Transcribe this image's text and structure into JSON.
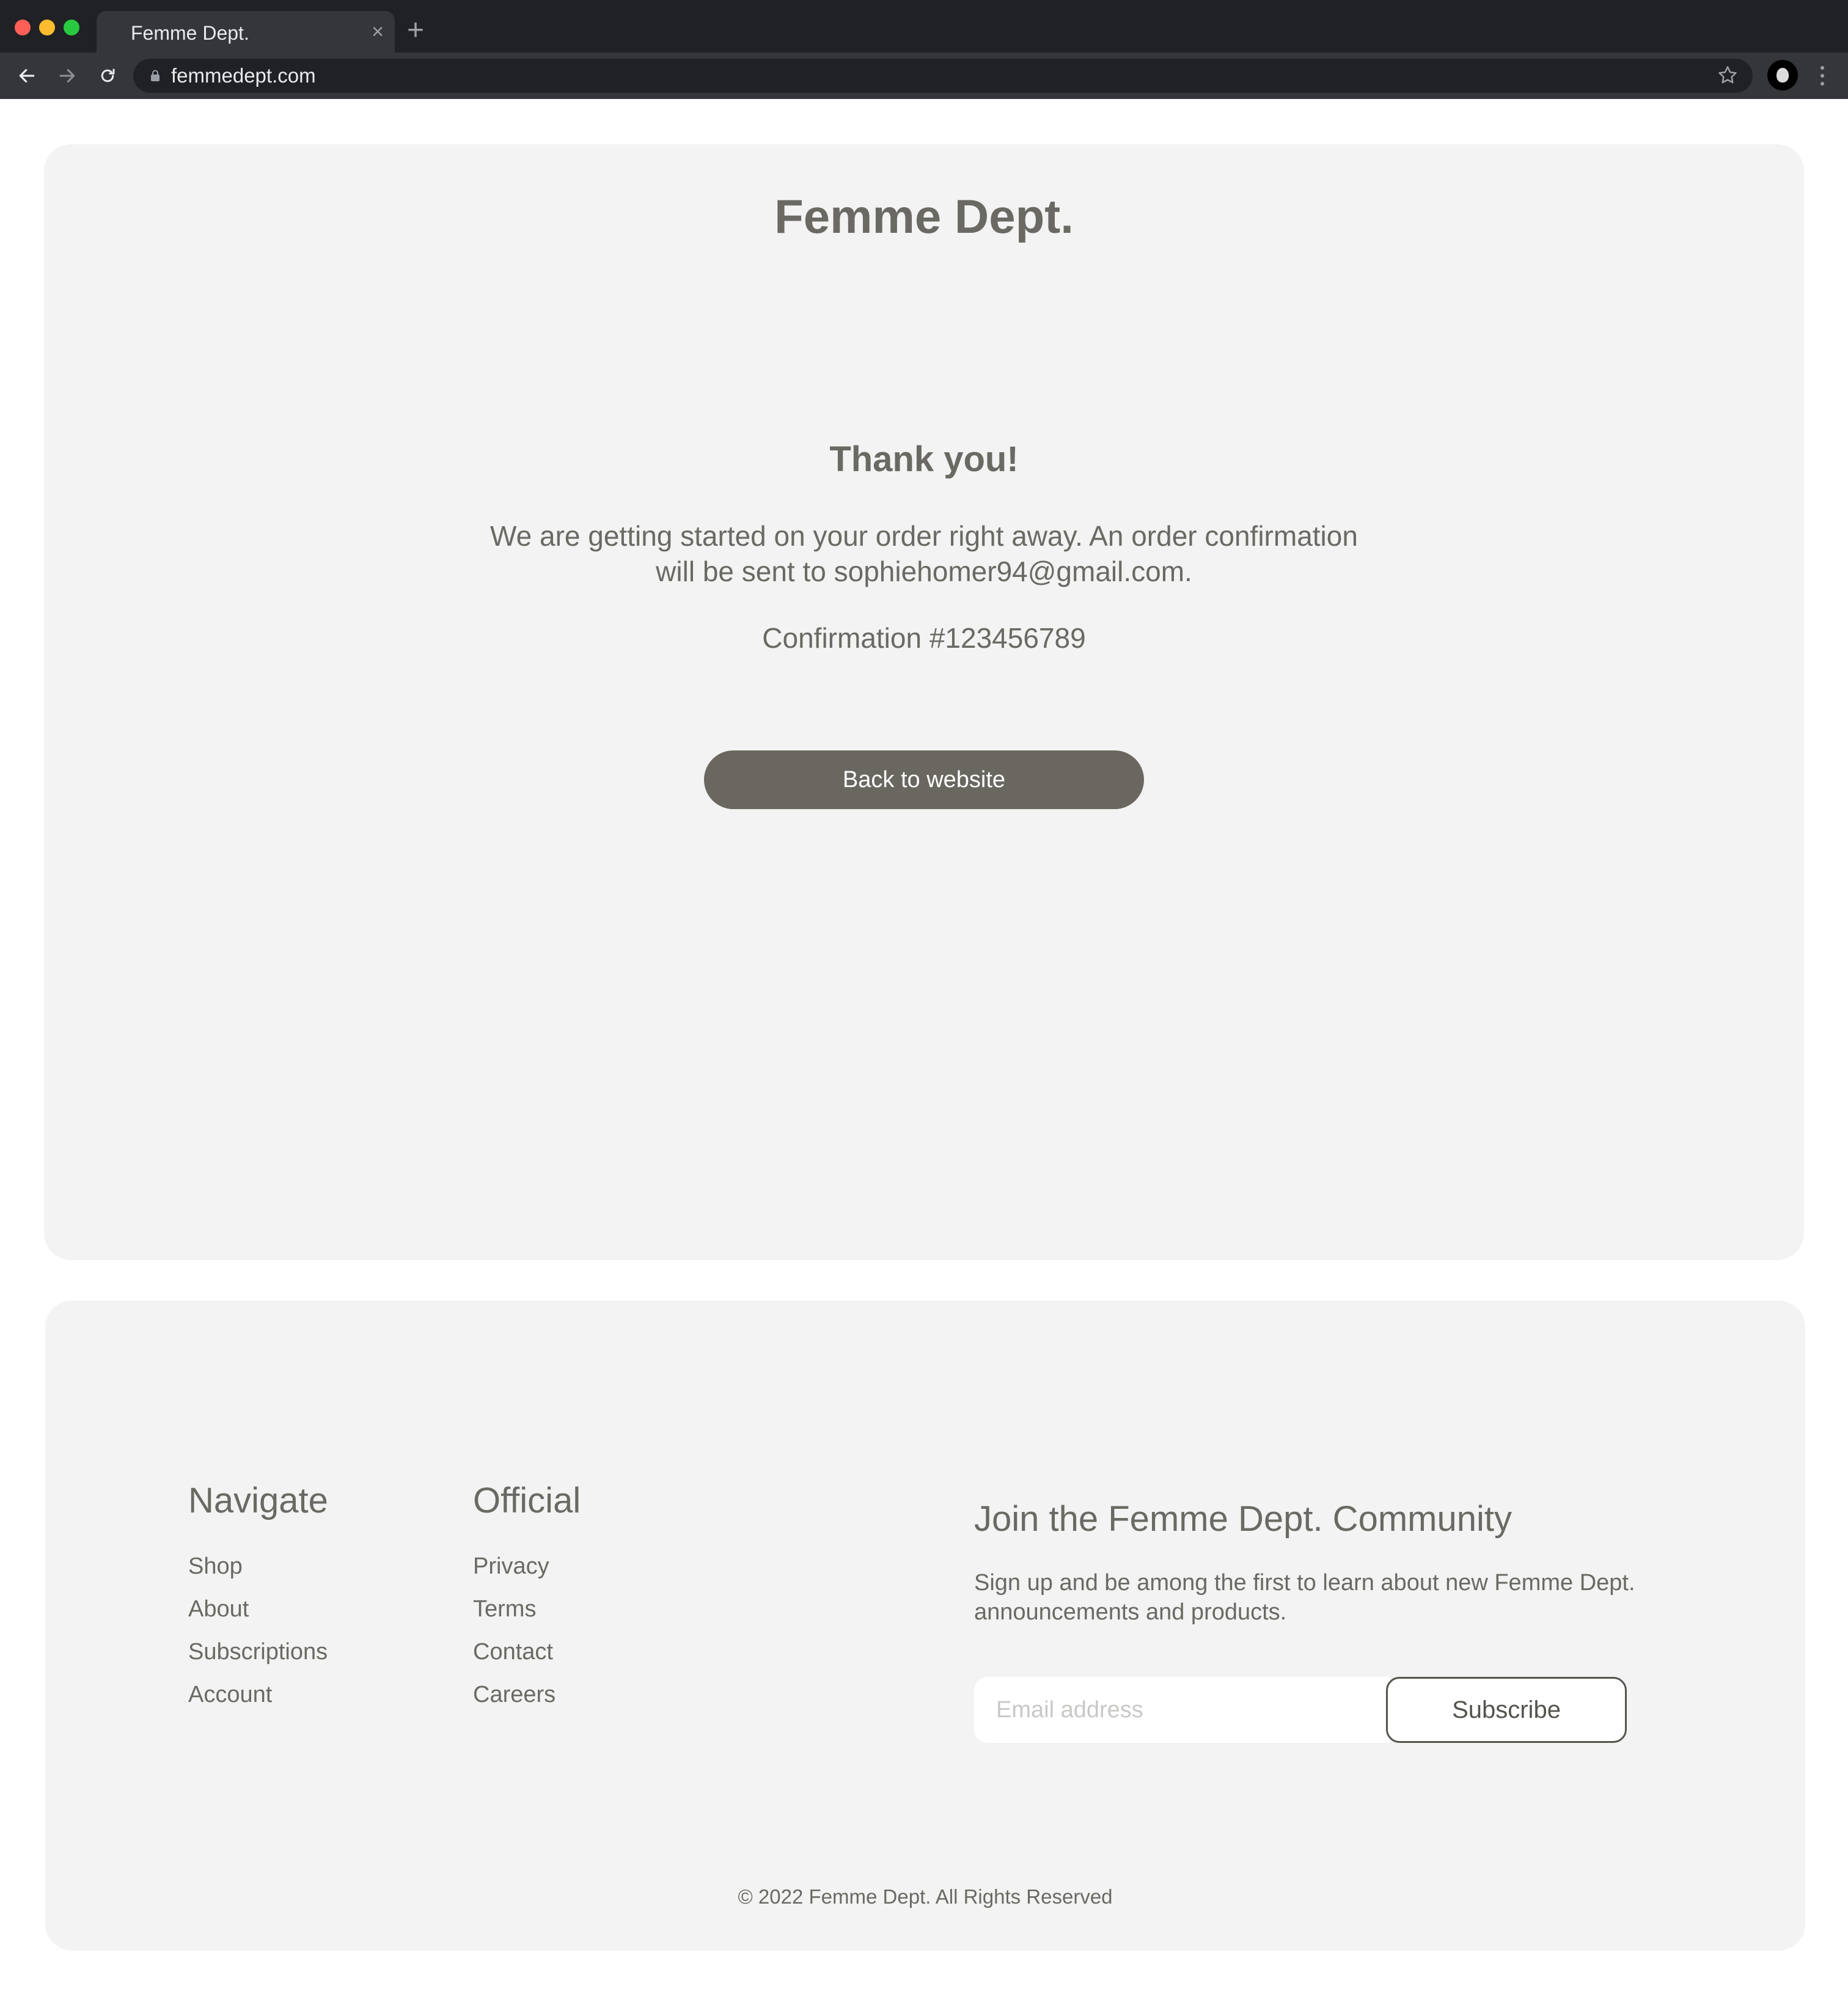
{
  "browser": {
    "tab_title": "Femme Dept.",
    "tab_close": "×",
    "new_tab": "+",
    "url": "femmedept.com"
  },
  "header": {
    "brand": "Femme Dept."
  },
  "confirmation": {
    "heading": "Thank you!",
    "message": "We are getting started on your order right away. An order confirmation will be sent to sophiehomer94@gmail.com.",
    "number": "Confirmation #123456789",
    "back_button": "Back to website"
  },
  "footer": {
    "navigate": {
      "title": "Navigate",
      "links": [
        "Shop",
        "About",
        "Subscriptions",
        "Account"
      ]
    },
    "official": {
      "title": "Official",
      "links": [
        "Privacy",
        "Terms",
        "Contact",
        "Careers"
      ]
    },
    "newsletter": {
      "title": "Join the Femme Dept. Community",
      "description": "Sign up and be among the first to learn about new Femme Dept. announcements and products.",
      "email_placeholder": "Email address",
      "subscribe_label": "Subscribe"
    },
    "copyright": "© 2022 Femme Dept. All Rights Reserved"
  },
  "colors": {
    "card_background": "#f2f3f2",
    "text": "#6a6964",
    "button": "#69675f"
  },
  "icons": [
    "back-arrow-icon",
    "forward-arrow-icon",
    "reload-icon",
    "lock-icon",
    "star-icon",
    "profile-avatar",
    "more-menu-icon"
  ]
}
